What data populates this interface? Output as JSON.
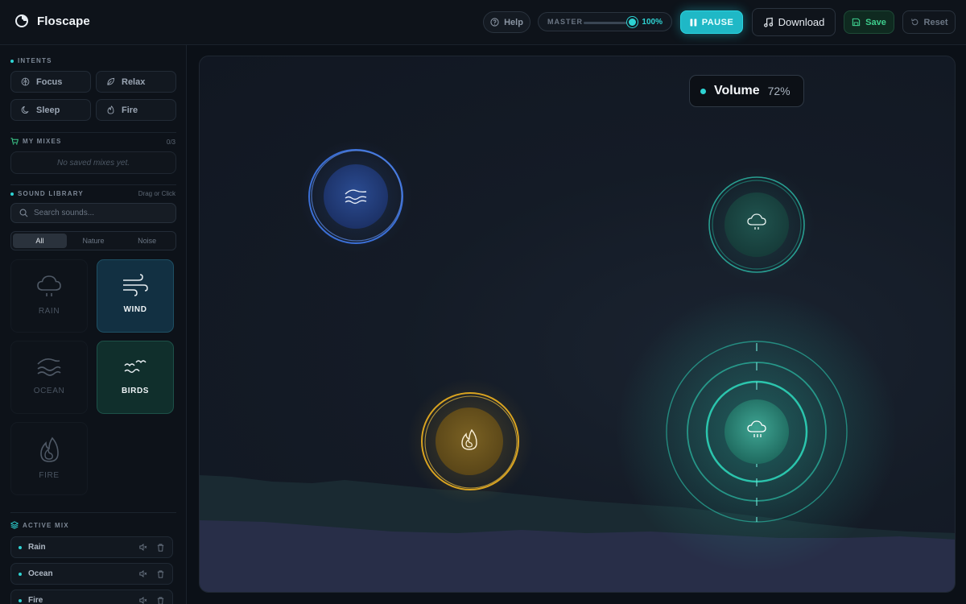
{
  "app": {
    "name": "Floscape"
  },
  "header": {
    "help_label": "Help",
    "master_label": "MASTER",
    "master_value": "100%",
    "master_level": 1.0,
    "pause_label": "PAUSE",
    "download_label": "Download",
    "save_label": "Save",
    "reset_label": "Reset"
  },
  "sidebar": {
    "intents_title": "INTENTS",
    "intents": [
      {
        "label": "Focus",
        "icon": "brain-icon"
      },
      {
        "label": "Relax",
        "icon": "leaf-icon"
      },
      {
        "label": "Sleep",
        "icon": "moon-icon"
      },
      {
        "label": "Fire",
        "icon": "flame-icon"
      }
    ],
    "mixes_title": "MY MIXES",
    "mixes_count": "0/3",
    "mixes_empty": "No saved mixes yet.",
    "library_title": "SOUND LIBRARY",
    "library_hint": "Drag or Click",
    "search_placeholder": "Search sounds...",
    "tabs": [
      "All",
      "Nature",
      "Noise"
    ],
    "active_tab": "All",
    "sounds": [
      {
        "label": "RAIN",
        "icon": "cloud-rain-icon",
        "active": false
      },
      {
        "label": "WIND",
        "icon": "wind-icon",
        "active": true
      },
      {
        "label": "OCEAN",
        "icon": "waves-icon",
        "active": false
      },
      {
        "label": "BIRDS",
        "icon": "birds-icon",
        "active": true
      },
      {
        "label": "FIRE",
        "icon": "flame-icon",
        "active": false
      }
    ],
    "active_mix_title": "ACTIVE MIX",
    "active_mix": [
      {
        "label": "Rain"
      },
      {
        "label": "Ocean"
      },
      {
        "label": "Fire"
      }
    ]
  },
  "canvas": {
    "volume_label": "Volume",
    "volume_value": "72%",
    "nodes": [
      {
        "name": "ocean-node",
        "icon": "waves-icon",
        "color": "#3b6fd6"
      },
      {
        "name": "rain-node",
        "icon": "cloud-rain-icon",
        "color": "#2bb5a3"
      },
      {
        "name": "fire-node",
        "icon": "flame-icon",
        "color": "#d9a320"
      },
      {
        "name": "storm-node",
        "icon": "cloud-rain-icon",
        "color": "#2ed3b8",
        "selected": true
      }
    ]
  },
  "colors": {
    "accent": "#2ed3d3",
    "save": "#3ecf8e",
    "background": "#0b1017"
  }
}
